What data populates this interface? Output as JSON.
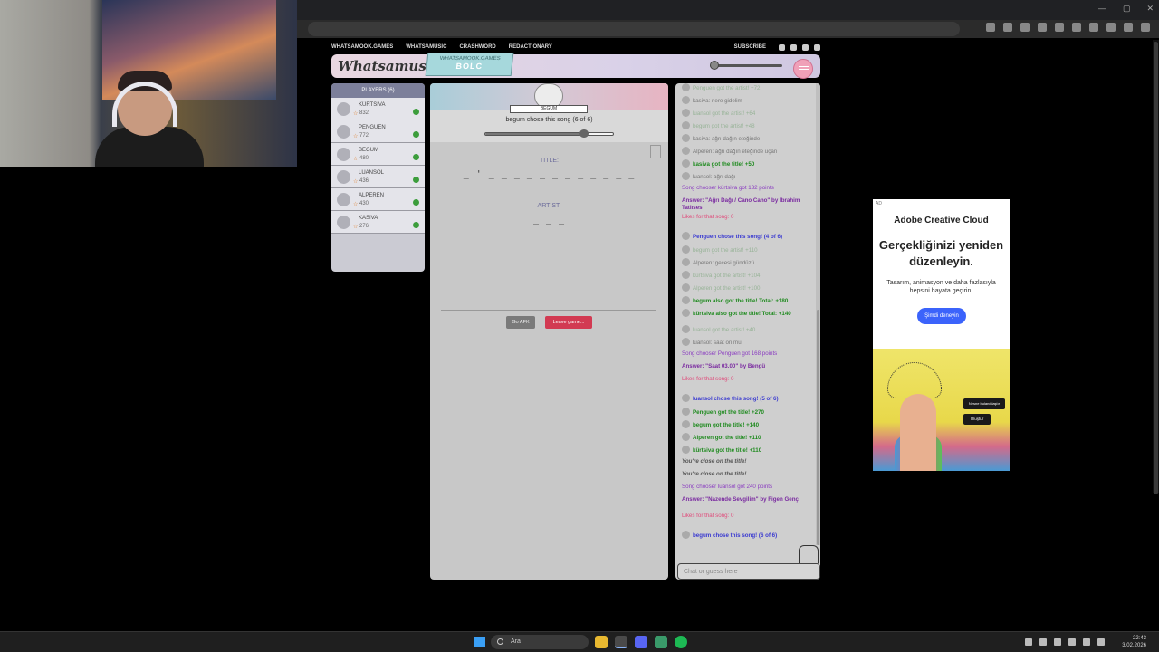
{
  "site_nav": {
    "home": "WHATSAMOOK.GAMES",
    "whatsamusic": "WHATSAMUSIC",
    "crashword": "CRASHWORD",
    "redactionary": "REDACTIONARY",
    "subscribe": "SUBSCRIBE"
  },
  "header": {
    "logo": "Whatsamusic",
    "room_site": "WHATSAMOOK.GAMES",
    "room_code": "BOLC"
  },
  "players": {
    "title": "PLAYERS (6)",
    "list": [
      {
        "name": "KÜRTSIVA",
        "score": "832"
      },
      {
        "name": "PENGUEN",
        "score": "772"
      },
      {
        "name": "BEGUM",
        "score": "480"
      },
      {
        "name": "LUANSOL",
        "score": "436"
      },
      {
        "name": "ALPEREN",
        "score": "430"
      },
      {
        "name": "KASIVA",
        "score": "276"
      }
    ]
  },
  "game": {
    "chooser_badge": "BEGUM",
    "chooser_text": "begum chose this song (6 of 6)",
    "song_progress": 0.78,
    "title_label": "TITLE:",
    "title_blanks": "_ ' _ _ _ _ _ _ _ _ _    _ _ _",
    "artist_label": "ARTIST:",
    "artist_blanks": "_ _ _",
    "afk_button": "Go AFK",
    "leave_button": "Leave game..."
  },
  "chat": {
    "messages": [
      {
        "text": "Penguen got the artist! +72",
        "style": "pale",
        "avatar": true
      },
      {
        "text": "kasiva: nere gidelim",
        "style": "gray",
        "avatar": true
      },
      {
        "text": "luansol got the artist! +64",
        "style": "pale",
        "avatar": true
      },
      {
        "text": "begum got the artist! +48",
        "style": "pale",
        "avatar": true
      },
      {
        "text": "kasiva: ağrı dağın eteğinde",
        "style": "gray",
        "avatar": true
      },
      {
        "text": "Alperen: ağrı dağın eteğinde uçan",
        "style": "gray",
        "avatar": true
      },
      {
        "text": "kasiva got the title! +50",
        "style": "green",
        "avatar": true
      },
      {
        "text": "luansol: ağrı dağı",
        "style": "gray",
        "avatar": true
      },
      {
        "text": "Song chooser kürtsiva got 132 points",
        "style": "purple",
        "avatar": false
      },
      {
        "text": "Answer: \"Ağrı Dağı / Cano Cano\" by İbrahim Tatlıses",
        "style": "answer",
        "avatar": false
      },
      {
        "text": "Likes for that song: 0",
        "style": "pink",
        "avatar": false
      },
      {
        "text": "Penguen chose this song! (4 of 6)",
        "style": "chooser",
        "avatar": true
      },
      {
        "text": "begum got the artist! +110",
        "style": "pale",
        "avatar": true
      },
      {
        "text": "Alperen: gecesi gündüzü",
        "style": "gray",
        "avatar": true
      },
      {
        "text": "kürtsiva got the artist! +104",
        "style": "pale",
        "avatar": true
      },
      {
        "text": "Alperen got the artist! +100",
        "style": "pale",
        "avatar": true
      },
      {
        "text": "begum also got the title! Total: +180",
        "style": "green",
        "avatar": true
      },
      {
        "text": "kürtsiva also got the title! Total: +140",
        "style": "green",
        "avatar": true
      },
      {
        "text": "luansol got the artist! +40",
        "style": "pale",
        "avatar": true
      },
      {
        "text": "luansol: saat on mu",
        "style": "gray",
        "avatar": true
      },
      {
        "text": "Song chooser Penguen got 168 points",
        "style": "purple",
        "avatar": false
      },
      {
        "text": "Answer: \"Saat 03.00\" by Bengü",
        "style": "answer",
        "avatar": false
      },
      {
        "text": "Likes for that song: 0",
        "style": "pink",
        "avatar": false
      },
      {
        "text": "luansol chose this song! (5 of 6)",
        "style": "chooser",
        "avatar": true
      },
      {
        "text": "Penguen got the title! +270",
        "style": "green",
        "avatar": true
      },
      {
        "text": "begum got the title! +140",
        "style": "green",
        "avatar": true
      },
      {
        "text": "Alperen got the title! +110",
        "style": "green",
        "avatar": true
      },
      {
        "text": "kürtsiva got the title! +110",
        "style": "green",
        "avatar": true
      },
      {
        "text": "You're close on the title!",
        "style": "close",
        "avatar": false
      },
      {
        "text": "You're close on the title!",
        "style": "close",
        "avatar": false
      },
      {
        "text": "Song chooser luansol got 240 points",
        "style": "purple",
        "avatar": false
      },
      {
        "text": "Answer: \"Nazende Sevgilim\" by Figen Genç",
        "style": "answer",
        "avatar": false
      },
      {
        "text": "Likes for that song: 0",
        "style": "pink",
        "avatar": false
      },
      {
        "text": "begum chose this song! (6 of 6)",
        "style": "chooser",
        "avatar": true
      }
    ],
    "input_placeholder": "Chat or guess here"
  },
  "ad": {
    "tag": "AD",
    "brand": "Adobe Creative Cloud",
    "headline": "Gerçekliğinizi yeniden düzenleyin.",
    "subtext": "Tasarım, animasyon ve daha fazlasıyla hepsini hayata geçirin.",
    "cta": "Şimdi deneyin",
    "chip1": "Nesne bulanıklaştır",
    "chip2": "Oluştur"
  },
  "taskbar": {
    "search_placeholder": "Ara",
    "time": "22:43",
    "date": "3.02.2026"
  }
}
